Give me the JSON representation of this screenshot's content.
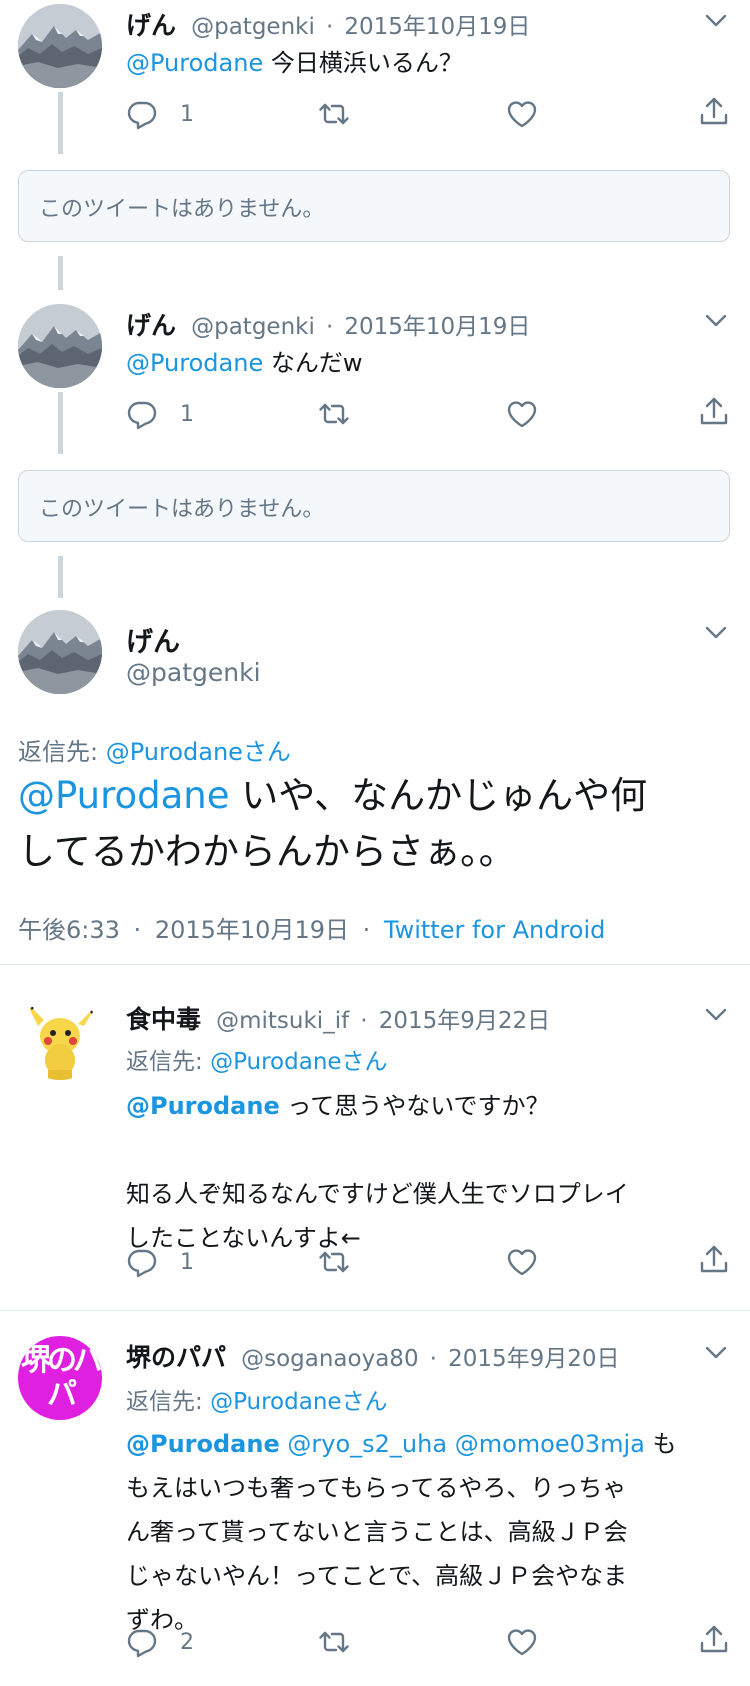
{
  "tweets": [
    {
      "name": "げん",
      "handle": "@patgenki",
      "date": "2015年10月19日",
      "mention": "@Purodane",
      "text": "今日横浜いるん？",
      "reply_count": "1"
    },
    {
      "name": "げん",
      "handle": "@patgenki",
      "date": "2015年10月19日",
      "mention": "@Purodane",
      "text": "なんだw",
      "reply_count": "1"
    }
  ],
  "unavailable_text": "このツイートはありません。",
  "main_tweet": {
    "name": "げん",
    "handle": "@patgenki",
    "reply_to_label": "返信先:",
    "reply_to_handle": "@Purodaneさん",
    "mention": "@Purodane",
    "text_line1": "いや、なんかじゅんや何",
    "text_line2": "してるかわからんからさぁ。。",
    "time": "午後6:33",
    "date": "2015年10月19日",
    "source": "Twitter for Android"
  },
  "replies": [
    {
      "name": "食中毒",
      "handle": "@mitsuki_if",
      "date": "2015年9月22日",
      "reply_to_label": "返信先:",
      "reply_to_handle": "@Purodaneさん",
      "mention": "@Purodane",
      "line1": "って思うやないですか？",
      "line2": "知る人ぞ知るなんですけど僕人生でソロプレイ",
      "line3": "したことないんすよ←",
      "reply_count": "1"
    },
    {
      "name": "堺のパパ",
      "handle": "@soganaoya80",
      "date": "2015年9月20日",
      "reply_to_label": "返信先:",
      "reply_to_handle": "@Purodaneさん",
      "mention": "@Purodane",
      "mention2": "@ryo_s2_uha",
      "mention3": "@momoe03mja",
      "line1_tail": "も",
      "line2": "もえはいつも奢ってもらってるやろ、りっちゃ",
      "line3": "ん奢って貰ってないと言うことは、高級ＪＰ会",
      "line4": "じゃないやん！ってことで、高級ＪＰ会やなま",
      "line5": "ずわ。",
      "reply_count": "2",
      "avatar_text": "堺のパパ"
    }
  ],
  "separator": "·",
  "icons": [
    "reply-icon",
    "retweet-icon",
    "like-icon",
    "share-icon",
    "chevron-down-icon"
  ],
  "colors": {
    "link": "#1b95e0",
    "meta": "#657786",
    "text": "#14171a",
    "border": "#ccd6dd"
  }
}
